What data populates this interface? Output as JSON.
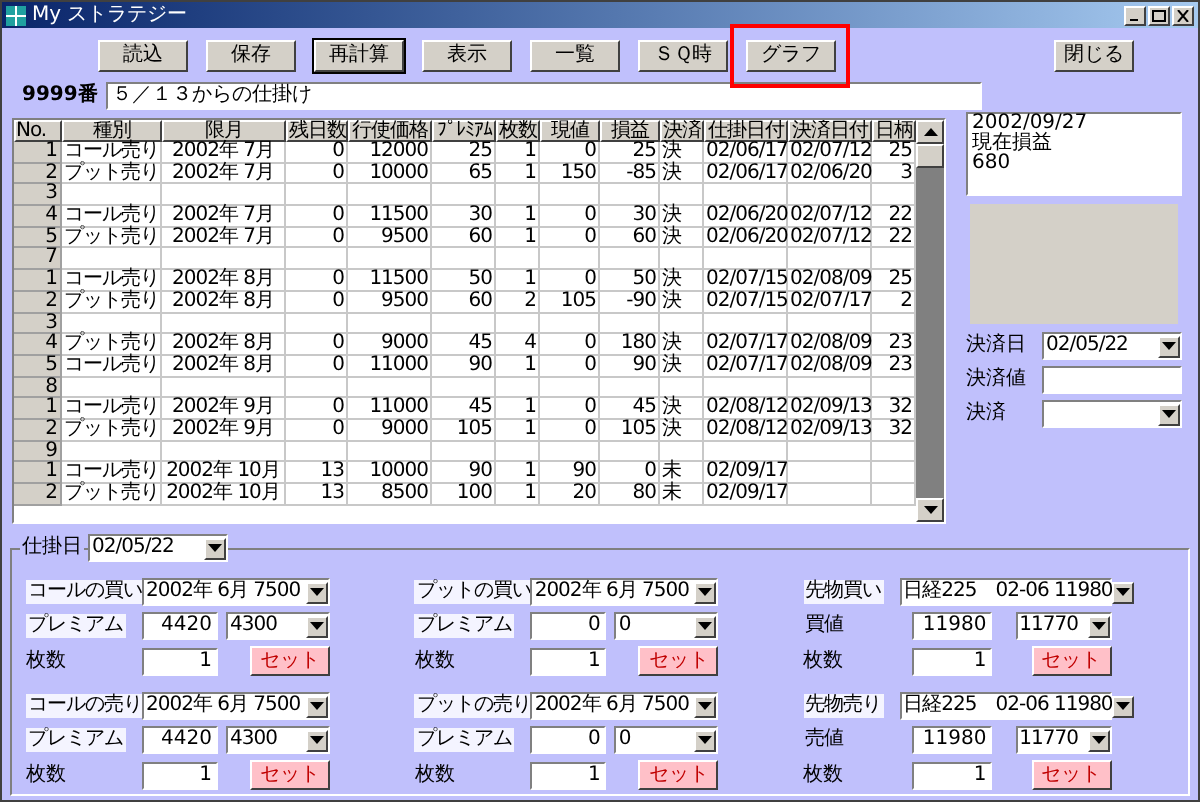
{
  "window": {
    "title": "My ストラテジー"
  },
  "toolbar": [
    {
      "label": "読込",
      "default": false,
      "highlighted": false
    },
    {
      "label": "保存",
      "default": false,
      "highlighted": false
    },
    {
      "label": "再計算",
      "default": true,
      "highlighted": false
    },
    {
      "label": "表示",
      "default": false,
      "highlighted": false
    },
    {
      "label": "一覧",
      "default": false,
      "highlighted": false
    },
    {
      "label": "ＳＱ時",
      "default": false,
      "highlighted": false
    },
    {
      "label": "グラフ",
      "default": false,
      "highlighted": true
    }
  ],
  "close_button": "閉じる",
  "strategy": {
    "number": "9999番",
    "name": "５／１３からの仕掛け"
  },
  "table": {
    "columns": [
      "No.",
      "種別",
      "限月",
      "残日数",
      "行使価格",
      "ﾌﾟﾚﾐｱﾑ",
      "枚数",
      "現値",
      "損益",
      "決済",
      "仕掛日付",
      "決済日付",
      "日柄"
    ],
    "rows": [
      {
        "cells": [
          "1",
          "コール売り",
          "2002年 7月",
          "0",
          "12000",
          "25",
          "1",
          "0",
          "25",
          "決",
          "02/06/17",
          "02/07/12",
          "25"
        ]
      },
      {
        "cells": [
          "2",
          "プット売り",
          "2002年 7月",
          "0",
          "10000",
          "65",
          "1",
          "150",
          "-85",
          "決",
          "02/06/17",
          "02/06/20",
          "3"
        ]
      },
      {
        "cells": [
          "3"
        ]
      },
      {
        "cells": [
          "4",
          "コール売り",
          "2002年 7月",
          "0",
          "11500",
          "30",
          "1",
          "0",
          "30",
          "決",
          "02/06/20",
          "02/07/12",
          "22"
        ]
      },
      {
        "cells": [
          "5",
          "プット売り",
          "2002年 7月",
          "0",
          "9500",
          "60",
          "1",
          "0",
          "60",
          "決",
          "02/06/20",
          "02/07/12",
          "22"
        ]
      },
      {
        "cells": [
          "7"
        ]
      },
      {
        "cells": [
          "1",
          "コール売り",
          "2002年 8月",
          "0",
          "11500",
          "50",
          "1",
          "0",
          "50",
          "決",
          "02/07/15",
          "02/08/09",
          "25"
        ]
      },
      {
        "cells": [
          "2",
          "プット売り",
          "2002年 8月",
          "0",
          "9500",
          "60",
          "2",
          "105",
          "-90",
          "決",
          "02/07/15",
          "02/07/17",
          "2"
        ]
      },
      {
        "cells": [
          "3"
        ]
      },
      {
        "cells": [
          "4",
          "プット売り",
          "2002年 8月",
          "0",
          "9000",
          "45",
          "4",
          "0",
          "180",
          "決",
          "02/07/17",
          "02/08/09",
          "23"
        ]
      },
      {
        "cells": [
          "5",
          "コール売り",
          "2002年 8月",
          "0",
          "11000",
          "90",
          "1",
          "0",
          "90",
          "決",
          "02/07/17",
          "02/08/09",
          "23"
        ]
      },
      {
        "cells": [
          "8"
        ]
      },
      {
        "cells": [
          "1",
          "コール売り",
          "2002年 9月",
          "0",
          "11000",
          "45",
          "1",
          "0",
          "45",
          "決",
          "02/08/12",
          "02/09/13",
          "32"
        ]
      },
      {
        "cells": [
          "2",
          "プット売り",
          "2002年 9月",
          "0",
          "9000",
          "105",
          "1",
          "0",
          "105",
          "決",
          "02/08/12",
          "02/09/13",
          "32"
        ]
      },
      {
        "cells": [
          "9"
        ]
      },
      {
        "cells": [
          "1",
          "コール売り",
          "2002年 10月",
          "13",
          "10000",
          "90",
          "1",
          "90",
          "0",
          "未",
          "02/09/17"
        ]
      },
      {
        "cells": [
          "2",
          "プット売り",
          "2002年 10月",
          "13",
          "8500",
          "100",
          "1",
          "20",
          "80",
          "未",
          "02/09/17"
        ]
      }
    ]
  },
  "summary": {
    "lines": [
      "2002/09/27",
      "現在損益",
      "680"
    ]
  },
  "settlement": [
    {
      "kind": "combo",
      "label": "決済日",
      "value": "02/05/22"
    },
    {
      "kind": "field",
      "label": "決済値"
    },
    {
      "kind": "combo",
      "label": "決済"
    }
  ],
  "entry": {
    "label": "仕掛日",
    "date": "02/05/22",
    "groups": [
      {
        "kind": "option",
        "label": {
          "text": "コールの買い",
          "boxed": true
        },
        "contract": "2002年 6月 7500",
        "price_label": {
          "text": "プレミアム",
          "boxed": true
        },
        "price": "4420",
        "price_choice": "4300",
        "qty_label": "枚数",
        "qty": "1",
        "button": "セット"
      },
      {
        "kind": "option",
        "label": {
          "text": "プットの買い",
          "boxed": true
        },
        "contract": "2002年 6月 7500",
        "price_label": {
          "text": "プレミアム",
          "boxed": true
        },
        "price": "0",
        "price_choice": "0",
        "qty_label": "枚数",
        "qty": "1",
        "button": "セット"
      },
      {
        "kind": "future",
        "label": {
          "text": "先物買い",
          "boxed": true
        },
        "contract": "日経225　02-06 11980",
        "price_label": {
          "text": "買値",
          "boxed": false
        },
        "price": "11980",
        "price_choice": "11770",
        "qty_label": "枚数",
        "qty": "1",
        "button": "セット"
      },
      {
        "kind": "option",
        "label": {
          "text": "コールの売り",
          "boxed": true
        },
        "contract": "2002年 6月 7500",
        "price_label": {
          "text": "プレミアム",
          "boxed": true
        },
        "price": "4420",
        "price_choice": "4300",
        "qty_label": "枚数",
        "qty": "1",
        "button": "セット"
      },
      {
        "kind": "option",
        "label": {
          "text": "プットの売り",
          "boxed": true
        },
        "contract": "2002年 6月 7500",
        "price_label": {
          "text": "プレミアム",
          "boxed": true
        },
        "price": "0",
        "price_choice": "0",
        "qty_label": "枚数",
        "qty": "1",
        "button": "セット"
      },
      {
        "kind": "future",
        "label": {
          "text": "先物売り",
          "boxed": true
        },
        "contract": "日経225　02-06 11980",
        "price_label": {
          "text": "売値",
          "boxed": false
        },
        "price": "11980",
        "price_choice": "11770",
        "qty_label": "枚数",
        "qty": "1",
        "button": "セット"
      }
    ]
  }
}
